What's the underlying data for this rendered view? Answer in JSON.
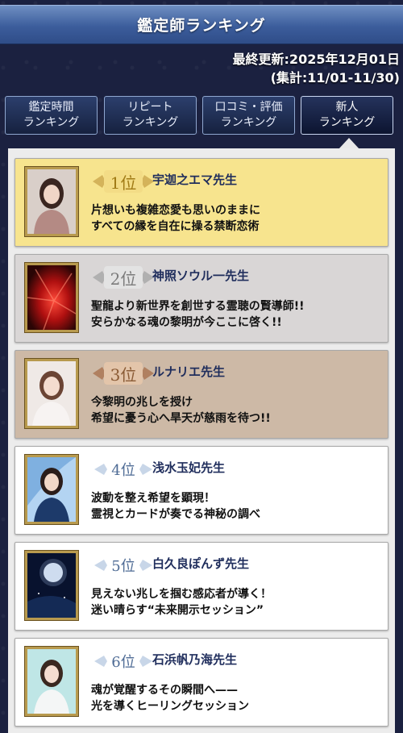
{
  "header": {
    "title": "鑑定師ランキング"
  },
  "updated": {
    "last_update": "最終更新:2025年12月01日",
    "period": "(集計:11/01-11/30)"
  },
  "tabs": [
    {
      "line1": "鑑定時間",
      "line2": "ランキング"
    },
    {
      "line1": "リピート",
      "line2": "ランキング"
    },
    {
      "line1": "口コミ・評価",
      "line2": "ランキング"
    },
    {
      "line1": "新人",
      "line2": "ランキング"
    }
  ],
  "active_tab": "新人ランキング",
  "rankings": [
    {
      "rank": "1位",
      "name": "宇迦之エマ先生",
      "line1": "片想いも複雑恋愛も思いのままに",
      "line2": "すべての縁を自在に操る禁断恋術"
    },
    {
      "rank": "2位",
      "name": "神照ソウル一先生",
      "line1": "聖龍より新世界を創世する霊聴の賢導師!!",
      "line2": "安らかなる魂の黎明が今ここに啓く!!"
    },
    {
      "rank": "3位",
      "name": "ルナリエ先生",
      "line1": "今黎明の兆しを授け",
      "line2": "希望に憂う心へ旱天が慈雨を待つ!!"
    },
    {
      "rank": "4位",
      "name": "浅水玉妃先生",
      "line1": "波動を整え希望を顕現！",
      "line2": "霊視とカードが奏でる神秘の調べ"
    },
    {
      "rank": "5位",
      "name": "白久良ぽんず先生",
      "line1": "見えない兆しを掴む感応者が導く！",
      "line2": "迷い晴らす“未来開示セッション”"
    },
    {
      "rank": "6位",
      "name": "石浜帆乃海先生",
      "line1": "魂が覚醒するその瞬間へ——",
      "line2": "光を導くヒーリングセッション"
    }
  ],
  "colors": {
    "gold_card": "#f7e48e",
    "silver_card": "#d9d6d6",
    "bronze_card": "#cdb9a6",
    "header": "#3c5d9c"
  }
}
